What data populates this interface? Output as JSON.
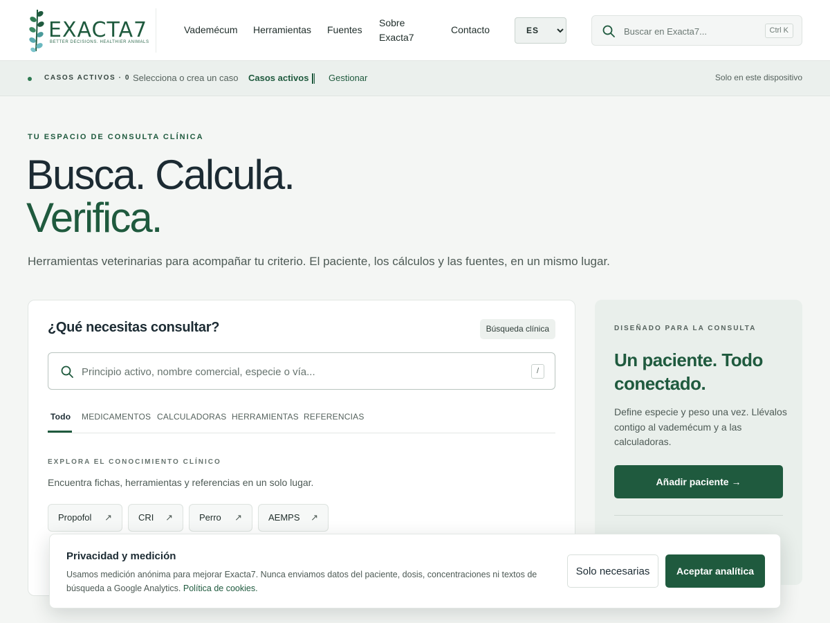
{
  "header": {
    "logo_text": "EXACTA7",
    "logo_tagline": "BETTER DECISIONS. HEALTHIER ANIMALS",
    "nav": [
      "Vademécum",
      "Herramientas",
      "Fuentes",
      "Sobre Exacta7",
      "Contacto"
    ],
    "lang": {
      "selected": "ES"
    },
    "search": {
      "placeholder": "Buscar en Exacta7...",
      "shortcut": "Ctrl K"
    }
  },
  "cases_bar": {
    "count_label": "CASOS ACTIVOS · 0",
    "hint": "Selecciona o crea un caso",
    "active_label": "Casos activos",
    "manage_label": "Gestionar",
    "device_note": "Solo en este dispositivo"
  },
  "hero": {
    "eyebrow": "TU ESPACIO DE CONSULTA CLÍNICA",
    "title_line1": "Busca. Calcula.",
    "title_line2": "Verifica.",
    "lead": "Herramientas veterinarias para acompañar tu criterio. El paciente, los cálculos y las fuentes, en un mismo lugar."
  },
  "search_card": {
    "title": "¿Qué necesitas consultar?",
    "badge": "Búsqueda clínica",
    "input_placeholder": "Principio activo, nombre comercial, especie o vía...",
    "shortcut": "/",
    "tabs": [
      "Todo",
      "MEDICAMENTOS",
      "CALCULADORAS",
      "HERRAMIENTAS",
      "REFERENCIAS"
    ],
    "active_tab": "Todo",
    "explore_eyebrow": "EXPLORA EL CONOCIMIENTO CLÍNICO",
    "explore_text": "Encuentra fichas, herramientas y referencias en un solo lugar.",
    "chips": [
      "Propofol",
      "CRI",
      "Perro",
      "AEMPS"
    ],
    "chip_arrow": "↗"
  },
  "side_card": {
    "eyebrow": "DISEÑADO PARA LA CONSULTA",
    "title": "Un paciente. Todo conectado.",
    "text": "Define especie y peso una vez. Llévalos contigo al vademécum y a las calculadoras.",
    "button": "Añadir paciente →"
  },
  "cookie_banner": {
    "title": "Privacidad y medición",
    "text": "Usamos medición anónima para mejorar Exacta7. Nunca enviamos datos del paciente, dosis, concentraciones ni textos de búsqueda a Google Analytics.",
    "link": "Política de cookies.",
    "btn_necessary": "Solo necesarias",
    "btn_accept": "Aceptar analítica"
  },
  "colors": {
    "brand_green": "#1f5a3e",
    "ink": "#1c2b33",
    "muted": "#4d5a55",
    "page_bg": "#f4f6f4"
  }
}
